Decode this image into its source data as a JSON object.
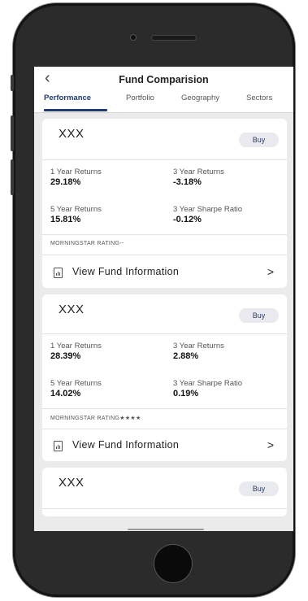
{
  "header": {
    "back_icon": "chevron-left-icon",
    "title": "Fund Comparision"
  },
  "tabs": [
    {
      "label": "Performance",
      "active": true
    },
    {
      "label": "Portfolio",
      "active": false
    },
    {
      "label": "Geography",
      "active": false
    },
    {
      "label": "Sectors",
      "active": false
    }
  ],
  "funds": [
    {
      "name": "XXX",
      "buy_label": "Buy",
      "one_year_label": "1 Year Returns",
      "one_year_value": "29.18%",
      "three_year_label": "3 Year Returns",
      "three_year_value": "-3.18%",
      "five_year_label": "5 Year Returns",
      "five_year_value": "15.81%",
      "sharpe_label": "3 Year Sharpe Ratio",
      "sharpe_value": "-0.12%",
      "rating_label": "MORNINGSTAR RATING--",
      "view_label": "View Fund Information"
    },
    {
      "name": "XXX",
      "buy_label": "Buy",
      "one_year_label": "1 Year Returns",
      "one_year_value": "28.39%",
      "three_year_label": "3 Year Returns",
      "three_year_value": "2.88%",
      "five_year_label": "5 Year Returns",
      "five_year_value": "14.02%",
      "sharpe_label": "3 Year Sharpe Ratio",
      "sharpe_value": "0.19%",
      "rating_label": "MORNINGSTAR RATING★★★★",
      "view_label": "View Fund Information"
    },
    {
      "name": "XXX",
      "buy_label": "Buy"
    }
  ],
  "colors": {
    "accent": "#1f3b73",
    "buy_background": "#e9eaee",
    "screen_background": "#ebebeb"
  }
}
